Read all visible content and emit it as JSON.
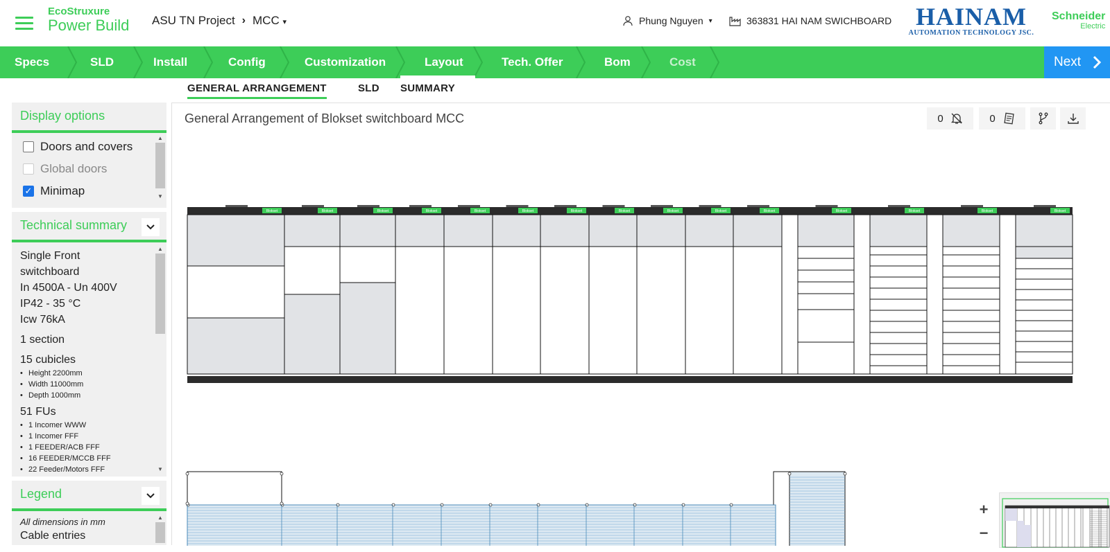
{
  "header": {
    "logo_line1": "EcoStruxure",
    "logo_line2": "Power Build",
    "project": "ASU TN Project",
    "switchboard": "MCC",
    "user": "Phung Nguyen",
    "project_code": "363831 HAI NAM SWICHBOARD",
    "partner_name": "HAINAM",
    "partner_sub": "AUTOMATION TECHNOLOGY JSC.",
    "brand_line1": "Schneider",
    "brand_line2": "Electric"
  },
  "steps": [
    {
      "label": "Specs"
    },
    {
      "label": "SLD"
    },
    {
      "label": "Install"
    },
    {
      "label": "Config"
    },
    {
      "label": "Customization"
    },
    {
      "label": "Layout"
    },
    {
      "label": "Tech. Offer"
    },
    {
      "label": "Bom"
    },
    {
      "label": "Cost"
    }
  ],
  "next_label": "Next",
  "tabs": [
    "GENERAL ARRANGEMENT",
    "SLD",
    "SUMMARY"
  ],
  "display_options": {
    "title": "Display options",
    "items": [
      {
        "label": "Doors and covers",
        "checked": false,
        "disabled": false
      },
      {
        "label": "Global doors",
        "checked": false,
        "disabled": true
      },
      {
        "label": "Minimap",
        "checked": true,
        "disabled": false
      }
    ]
  },
  "technical_summary": {
    "title": "Technical summary",
    "lines": [
      "Single Front",
      "switchboard",
      "In 4500A - Un 400V",
      "IP42 - 35 °C",
      "Icw 76kA"
    ],
    "sections": "1 section",
    "cubicles": "15 cubicles",
    "dims": [
      "Height 2200mm",
      "Width 11000mm",
      "Depth 1000mm"
    ],
    "fus": "51 FUs",
    "fu_list": [
      "1 Incomer WWW",
      "1 Incomer FFF",
      "1 FEEDER/ACB FFF",
      "16 FEEDER/MCCB FFF",
      "22 Feeder/Motors FFF"
    ]
  },
  "legend": {
    "title": "Legend",
    "note": "All dimensions in mm",
    "item1": "Cable entries"
  },
  "main": {
    "title": "General Arrangement of  Blokset switchboard MCC",
    "alerts_count": "0",
    "notes_count": "0",
    "zoom_in": "+",
    "zoom_out": "−",
    "nameplate": "Blokset"
  },
  "icons": {
    "menu": "hamburger-icon",
    "user": "user-icon",
    "building": "factory-icon",
    "bell": "bell-off-icon",
    "notes": "notes-icon",
    "branch": "branch-icon",
    "download": "download-icon"
  },
  "colors": {
    "accent": "#3dcd58",
    "next": "#2196f3",
    "partner": "#1a5ea8",
    "cell_fill": "#e1e3e6",
    "base": "#2b2b2b"
  }
}
